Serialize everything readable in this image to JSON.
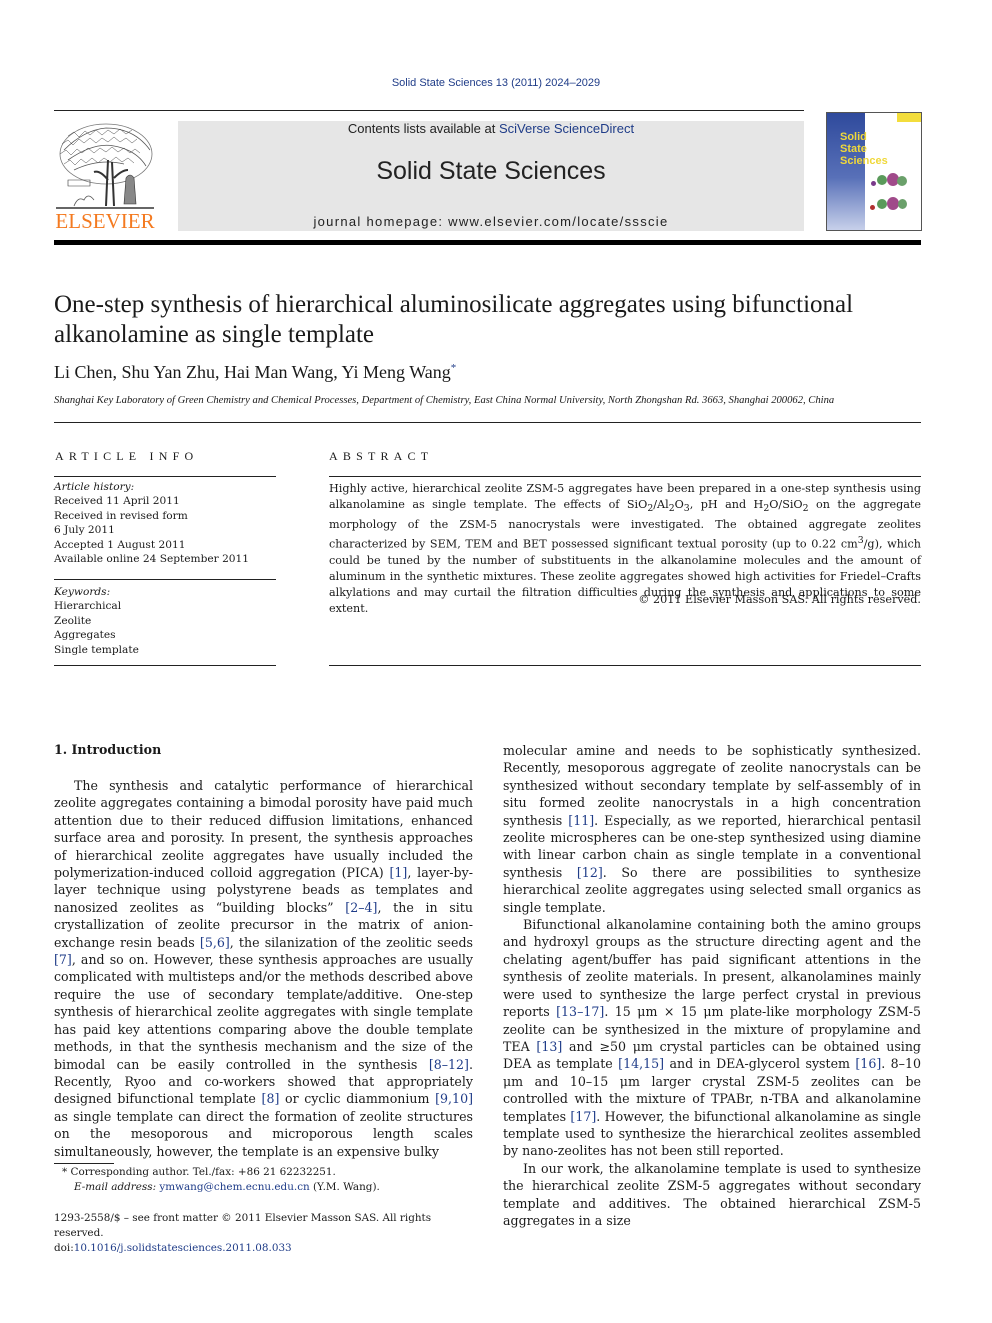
{
  "header": {
    "journal_ref": "Solid State Sciences 13 (2011) 2024–2029",
    "publisher_logo_text": "ELSEVIER",
    "contents_prefix": "Contents lists available at ",
    "contents_link": "SciVerse ScienceDirect",
    "journal_name": "Solid State Sciences",
    "homepage": "journal homepage: www.elsevier.com/locate/ssscie",
    "cover_title_lines": [
      "Solid",
      "State",
      "Sciences"
    ],
    "colors": {
      "link": "#1f3c88",
      "elsevier_orange": "#f47a20",
      "banner_gray": "#e6e6e6"
    }
  },
  "article": {
    "title": "One-step synthesis of hierarchical aluminosilicate aggregates using bifunctional alkanolamine as single template",
    "authors": "Li Chen, Shu Yan Zhu, Hai Man Wang, Yi Meng Wang",
    "corresponding_mark": "*",
    "affiliation": "Shanghai Key Laboratory of Green Chemistry and Chemical Processes, Department of Chemistry, East China Normal University, North Zhongshan Rd. 3663, Shanghai 200062, China"
  },
  "article_info": {
    "heading": "ARTICLE INFO",
    "history_label": "Article history:",
    "history": [
      "Received 11 April 2011",
      "Received in revised form",
      "6 July 2011",
      "Accepted 1 August 2011",
      "Available online 24 September 2011"
    ],
    "keywords_label": "Keywords:",
    "keywords": [
      "Hierarchical",
      "Zeolite",
      "Aggregates",
      "Single template"
    ]
  },
  "abstract": {
    "heading": "ABSTRACT",
    "text_1": "Highly active, hierarchical zeolite ZSM-5 aggregates have been prepared in a one-step synthesis using alkanolamine as single template. The effects of SiO",
    "text_2": "/Al",
    "text_3": "O",
    "text_4": ", pH and H",
    "text_5": "O/SiO",
    "text_6": " on the aggregate morphology of the ZSM-5 nanocrystals were investigated. The obtained aggregate zeolites characterized by SEM, TEM and BET possessed significant textual porosity (up to 0.22 cm",
    "text_7": "/g), which could be tuned by the number of substituents in the alkanolamine molecules and the amount of aluminum in the synthetic mixtures. These zeolite aggregates showed high activities for Friedel–Crafts alkylations and may curtail the filtration difficulties during the synthesis and applications to some extent.",
    "sub_2": "2",
    "sub_3": "3",
    "sup_3": "3",
    "copyright": "© 2011 Elsevier Masson SAS. All rights reserved."
  },
  "body": {
    "section_heading": "1.  Introduction",
    "left": {
      "p1_a": "The synthesis and catalytic performance of hierarchical zeolite aggregates containing a bimodal porosity have paid much attention due to their reduced diffusion limitations, enhanced surface area and porosity. In present, the synthesis approaches of hierarchical zeolite aggregates have usually included the polymerization-induced colloid aggregation (PICA) ",
      "ref_1": "[1]",
      "p1_b": ", layer-by-layer technique using polystyrene beads as templates and nanosized zeolites as “building blocks” ",
      "ref_2": "[2–4]",
      "p1_c": ", the in situ crystallization of zeolite precursor in the matrix of anion-exchange resin beads ",
      "ref_3": "[5,6]",
      "p1_d": ", the silanization of the zeolitic seeds ",
      "ref_4": "[7]",
      "p1_e": ", and so on. However, these synthesis approaches are usually complicated with multisteps and/or the methods described above require the use of secondary template/additive. One-step synthesis of hierarchical zeolite aggregates with single template has paid key attentions comparing above the double template methods, in that the synthesis mechanism and the size of the bimodal can be easily controlled in the synthesis ",
      "ref_5": "[8–12]",
      "p1_f": ". Recently, Ryoo and co-workers showed that appropriately designed bifunctional template ",
      "ref_6": "[8]",
      "p1_g": " or cyclic diammonium ",
      "ref_7": "[9,10]",
      "p1_h": " as single template can direct the formation of zeolite structures on the mesoporous and microporous length scales simultaneously, however, the template is an expensive bulky"
    },
    "right": {
      "p1_a": "molecular amine and needs to be sophisticatly synthesized. Recently, mesoporous aggregate of zeolite nanocrystals can be synthesized without secondary template by self-assembly of in situ formed zeolite nanocrystals in a high concentration synthesis ",
      "ref_1": "[11]",
      "p1_b": ". Especially, as we reported, hierarchical pentasil zeolite microspheres can be one-step synthesized using diamine with linear carbon chain as single template in a conventional synthesis ",
      "ref_2": "[12]",
      "p1_c": ". So there are possibilities to synthesize hierarchical zeolite aggregates using selected small organics as single template.",
      "p2_a": "Bifunctional alkanolamine containing both the amino groups and hydroxyl groups as the structure directing agent and the chelating agent/buffer has paid significant attentions in the synthesis of zeolite materials. In present, alkanolamines mainly were used to synthesize the large perfect crystal in previous reports ",
      "ref_3": "[13–17]",
      "p2_b": ". 15 μm × 15 μm plate-like morphology ZSM-5 zeolite can be synthesized in the mixture of propylamine and TEA ",
      "ref_4": "[13]",
      "p2_c": " and ≥50 μm crystal particles can be obtained using DEA as template ",
      "ref_5": "[14,15]",
      "p2_d": " and in DEA-glycerol system ",
      "ref_6": "[16]",
      "p2_e": ". 8–10 μm and 10–15 μm larger crystal ZSM-5 zeolites can be controlled with the mixture of TPABr, n-TBA and alkanolamine templates ",
      "ref_7": "[17]",
      "p2_f": ". However, the bifunctional alkanolamine as single template used to synthesize the hierarchical zeolites assembled by nano-zeolites has not been still reported.",
      "p3": "In our work, the alkanolamine template is used to synthesize the hierarchical zeolite ZSM-5 aggregates without secondary template and additives. The obtained hierarchical ZSM-5 aggregates in a size"
    }
  },
  "footnote": {
    "mark": "*",
    "corresponding": " Corresponding author. Tel./fax: +86 21 62232251.",
    "email_label": "E-mail address: ",
    "email": "ymwang@chem.ecnu.edu.cn",
    "email_suffix": " (Y.M. Wang)."
  },
  "front_matter": {
    "issn_line": "1293-2558/$ – see front matter © 2011 Elsevier Masson SAS. All rights reserved.",
    "doi_prefix": "doi:",
    "doi": "10.1016/j.solidstatesciences.2011.08.033"
  }
}
